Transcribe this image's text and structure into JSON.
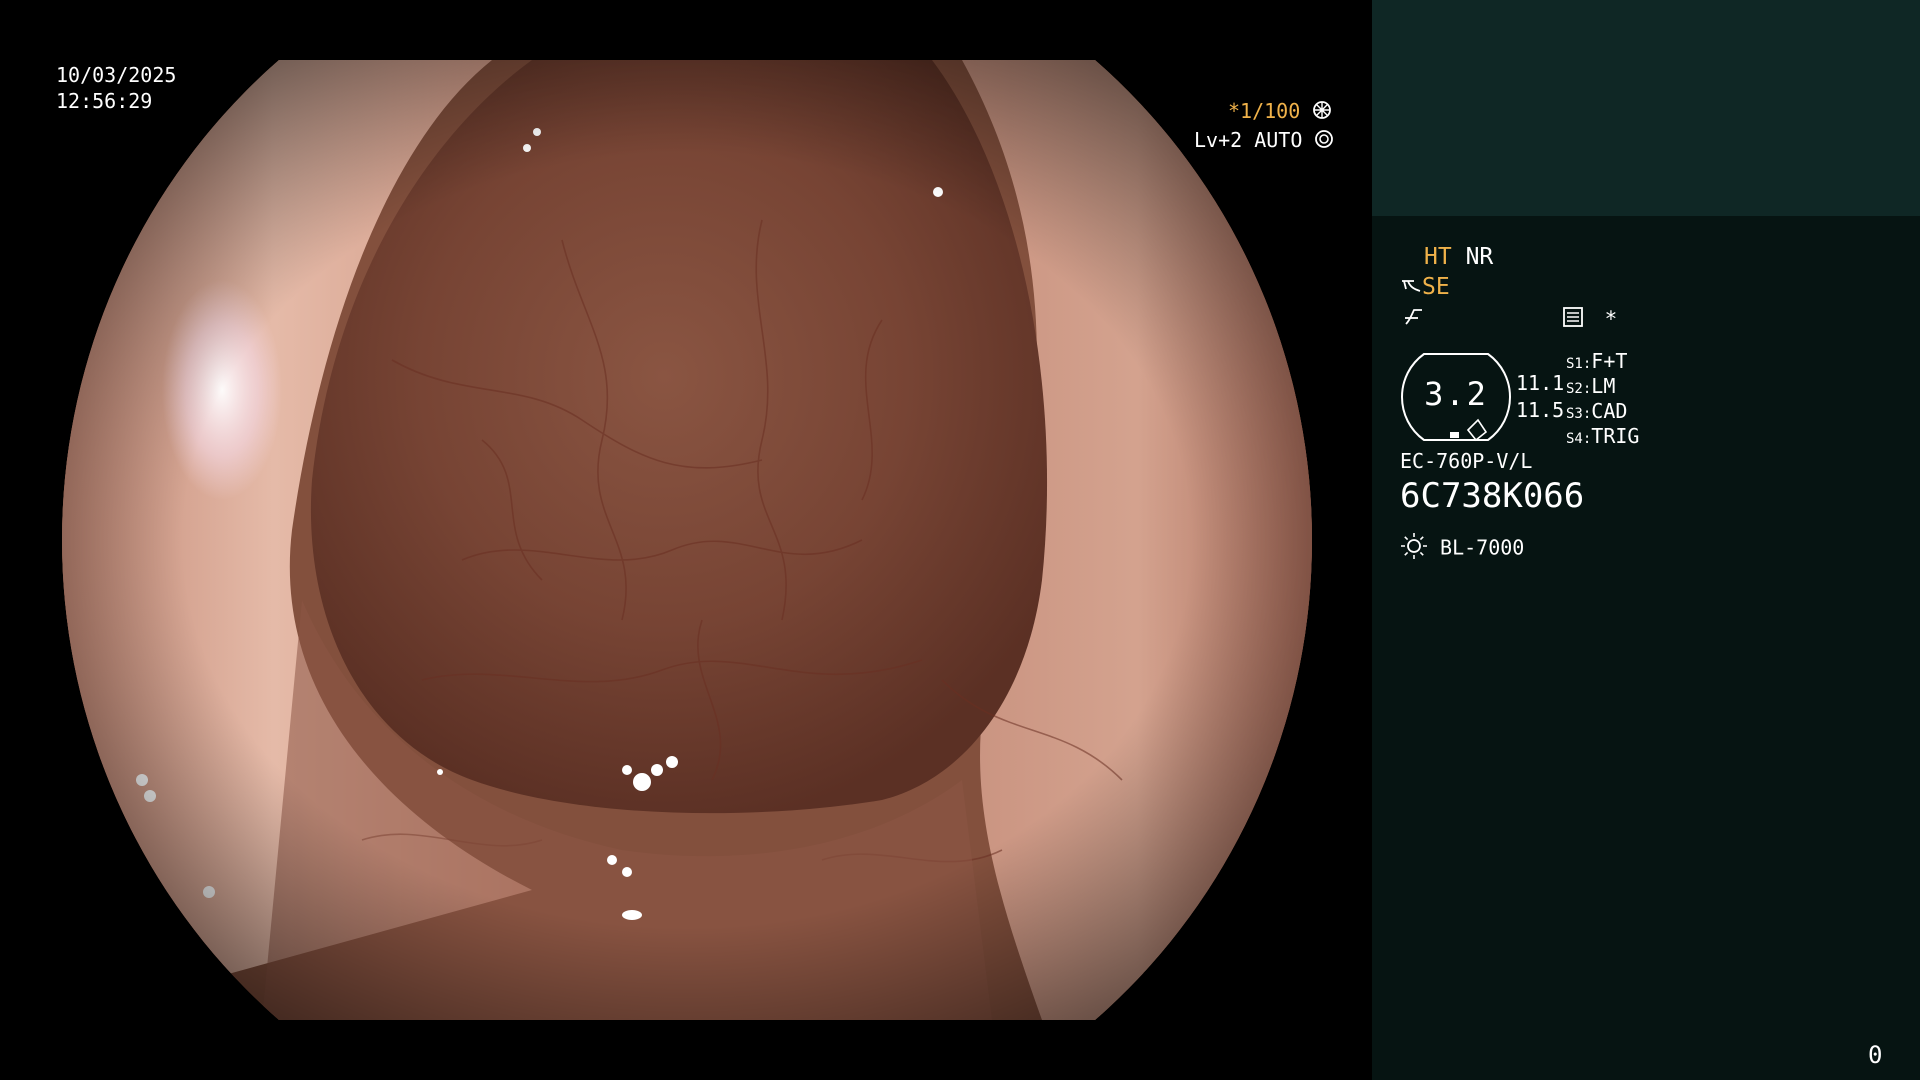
{
  "overlay": {
    "date": "10/03/2025",
    "time": "12:56:29",
    "shutter": "*1/100",
    "shutter_icon": "aperture-icon",
    "level": "Lv+2 AUTO",
    "level_icon": "iris-icon"
  },
  "panel": {
    "ht_label": "HT",
    "nr_label": "NR",
    "se_label": "SE",
    "se_icon": "enhance-icon",
    "filter_icon": "filter-icon",
    "memory_icon": "memory-card-icon",
    "asterisk": "*",
    "zoom": {
      "value": "3.2",
      "icon": "zoom-badge-icon"
    },
    "readouts": [
      "11.1",
      "11.5"
    ],
    "scene_modes": [
      {
        "key": "S1",
        "value": "F+T"
      },
      {
        "key": "S2",
        "value": "LM"
      },
      {
        "key": "S3",
        "value": "CAD"
      },
      {
        "key": "S4",
        "value": "TRIG"
      }
    ],
    "scope_model": "EC-760P-V/L",
    "scope_serial": "6C738K066",
    "light_source": "BL-7000",
    "light_icon": "lamp-icon",
    "counter": "0"
  },
  "colors": {
    "panel_bg": "#061412",
    "panel_top_bg": "#0f2725",
    "accent_orange": "#f0b24a",
    "text": "#ffffff"
  }
}
